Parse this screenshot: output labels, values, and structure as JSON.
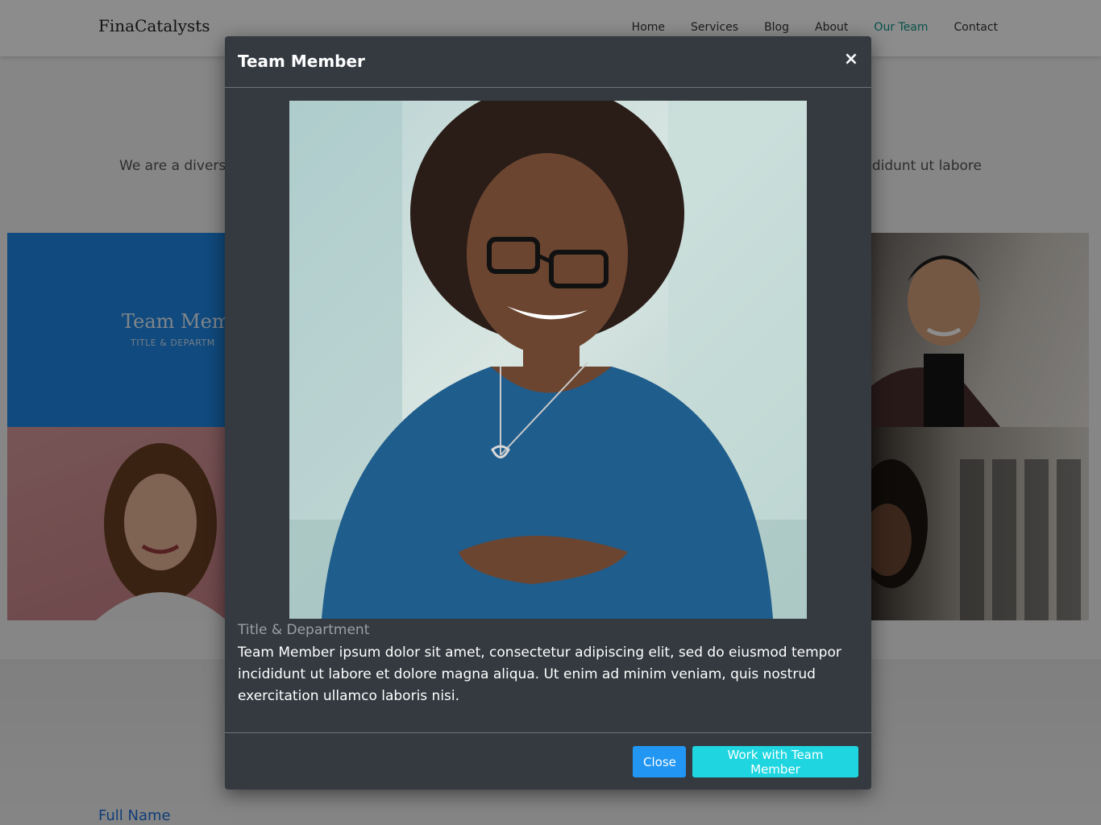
{
  "site": {
    "brand": "FinaCatalysts",
    "nav": [
      {
        "label": "Home"
      },
      {
        "label": "Services"
      },
      {
        "label": "Blog"
      },
      {
        "label": "About"
      },
      {
        "label": "Our Team",
        "active": true
      },
      {
        "label": "Contact"
      }
    ],
    "intro_left": "We are a diverse",
    "intro_right": "ididunt ut labore",
    "tile_title": "Team Mem",
    "tile_subtitle": "TITLE & DEPARTM",
    "full_name_label": "Full Name"
  },
  "modal": {
    "title": "Team Member",
    "close_icon": "×",
    "department": "Title & Department",
    "bio": "Team Member ipsum dolor sit amet, consectetur adipiscing elit, sed do eiusmod tempor incididunt ut labore et dolore magna aliqua. Ut enim ad minim veniam, quis nostrud exercitation ullamco laboris nisi.",
    "buttons": {
      "close": "Close",
      "work": "Work with Team Member"
    }
  },
  "colors": {
    "accent_teal": "#0d9488",
    "tile_blue": "#1e88e5",
    "modal_bg": "#343a40",
    "btn_primary": "#2196f3",
    "btn_info": "#1fd6e0"
  }
}
